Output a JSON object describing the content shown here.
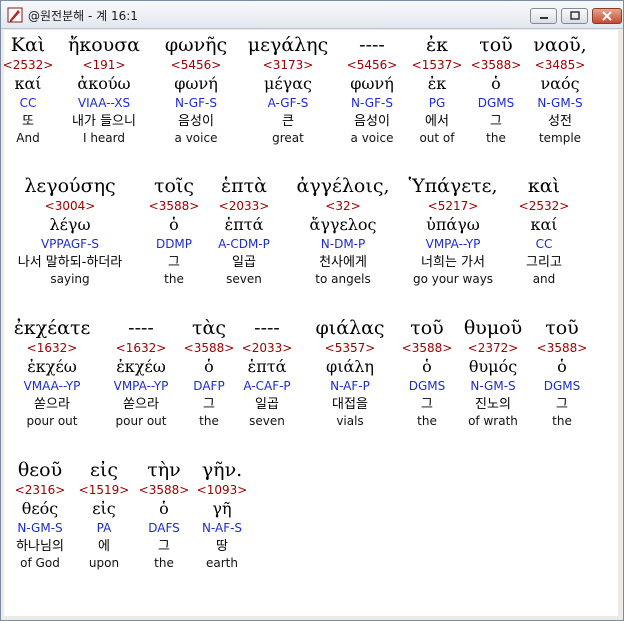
{
  "window": {
    "title": "@원전분해 - 계 16:1",
    "buttons": {
      "minimize": "minimize-icon",
      "maximize": "maximize-icon",
      "close": "close-icon"
    }
  },
  "rows": [
    [
      {
        "greek": "Καὶ",
        "strong": "<2532>",
        "lemma": "καί",
        "morph": "CC",
        "korean": "또",
        "english": "And"
      },
      {
        "greek": "ἤκουσα",
        "strong": "<191>",
        "lemma": "ἀκούω",
        "morph": "VIAA--XS",
        "korean": "내가 들으니",
        "english": "I heard"
      },
      {
        "greek": "φωνῆς",
        "strong": "<5456>",
        "lemma": "φωνή",
        "morph": "N-GF-S",
        "korean": "음성이",
        "english": "a voice"
      },
      {
        "greek": "μεγάλης",
        "strong": "<3173>",
        "lemma": "μέγας",
        "morph": "A-GF-S",
        "korean": "큰",
        "english": "great"
      },
      {
        "greek": "----",
        "strong": "<5456>",
        "lemma": "φωνή",
        "morph": "N-GF-S",
        "korean": "음성이",
        "english": "a voice"
      },
      {
        "greek": "ἐκ",
        "strong": "<1537>",
        "lemma": "ἐκ",
        "morph": "PG",
        "korean": "에서",
        "english": "out of"
      },
      {
        "greek": "τοῦ",
        "strong": "<3588>",
        "lemma": "ὁ",
        "morph": "DGMS",
        "korean": "그",
        "english": "the"
      },
      {
        "greek": "ναοῦ,",
        "strong": "<3485>",
        "lemma": "ναός",
        "morph": "N-GM-S",
        "korean": "성전",
        "english": "temple"
      }
    ],
    [
      {
        "greek": "λεγούσης",
        "strong": "<3004>",
        "lemma": "λέγω",
        "morph": "VPPAGF-S",
        "korean": "나서 말하되-하더라",
        "english": "saying"
      },
      {
        "greek": "τοῖς",
        "strong": "<3588>",
        "lemma": "ὁ",
        "morph": "DDMP",
        "korean": "그",
        "english": "the"
      },
      {
        "greek": "ἑπτὰ",
        "strong": "<2033>",
        "lemma": "ἑπτά",
        "morph": "A-CDM-P",
        "korean": "일곱",
        "english": "seven"
      },
      {
        "greek": "ἀγγέλοις,",
        "strong": "<32>",
        "lemma": "ἄγγελος",
        "morph": "N-DM-P",
        "korean": "천사에게",
        "english": "to angels"
      },
      {
        "greek": "Ὑπάγετε,",
        "strong": "<5217>",
        "lemma": "ὑπάγω",
        "morph": "VMPA--YP",
        "korean": "너희는 가서",
        "english": "go your ways"
      },
      {
        "greek": "καὶ",
        "strong": "<2532>",
        "lemma": "καί",
        "morph": "CC",
        "korean": "그리고",
        "english": "and"
      }
    ],
    [
      {
        "greek": "ἐκχέατε",
        "strong": "<1632>",
        "lemma": "ἐκχέω",
        "morph": "VMAA--YP",
        "korean": "쏟으라",
        "english": "pour out"
      },
      {
        "greek": "----",
        "strong": "<1632>",
        "lemma": "ἐκχέω",
        "morph": "VMPA--YP",
        "korean": "쏟으라",
        "english": "pour out"
      },
      {
        "greek": "τὰς",
        "strong": "<3588>",
        "lemma": "ὁ",
        "morph": "DAFP",
        "korean": "그",
        "english": "the"
      },
      {
        "greek": "----",
        "strong": "<2033>",
        "lemma": "ἑπτά",
        "morph": "A-CAF-P",
        "korean": "일곱",
        "english": "seven"
      },
      {
        "greek": "φιάλας",
        "strong": "<5357>",
        "lemma": "φιάλη",
        "morph": "N-AF-P",
        "korean": "대접을",
        "english": "vials"
      },
      {
        "greek": "τοῦ",
        "strong": "<3588>",
        "lemma": "ὁ",
        "morph": "DGMS",
        "korean": "그",
        "english": "the"
      },
      {
        "greek": "θυμοῦ",
        "strong": "<2372>",
        "lemma": "θυμός",
        "morph": "N-GM-S",
        "korean": "진노의",
        "english": "of wrath"
      },
      {
        "greek": "τοῦ",
        "strong": "<3588>",
        "lemma": "ὁ",
        "morph": "DGMS",
        "korean": "그",
        "english": "the"
      }
    ],
    [
      {
        "greek": "θεοῦ",
        "strong": "<2316>",
        "lemma": "θεός",
        "morph": "N-GM-S",
        "korean": "하나님의",
        "english": "of God"
      },
      {
        "greek": "εἰς",
        "strong": "<1519>",
        "lemma": "εἰς",
        "morph": "PA",
        "korean": "에",
        "english": "upon"
      },
      {
        "greek": "τὴν",
        "strong": "<3588>",
        "lemma": "ὁ",
        "morph": "DAFS",
        "korean": "그",
        "english": "the"
      },
      {
        "greek": "γῆν.",
        "strong": "<1093>",
        "lemma": "γῆ",
        "morph": "N-AF-S",
        "korean": "땅",
        "english": "earth"
      }
    ]
  ]
}
